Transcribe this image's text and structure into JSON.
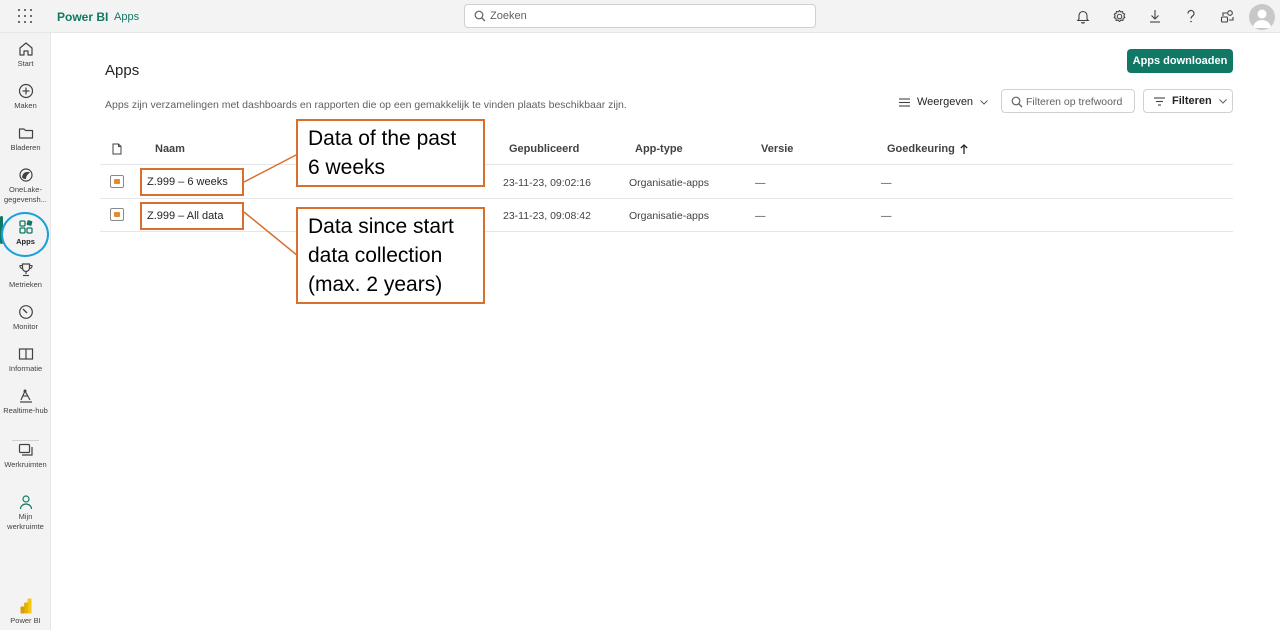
{
  "topbar": {
    "brand": "Power BI",
    "section": "Apps",
    "search_placeholder": "Zoeken"
  },
  "rail": {
    "items": [
      {
        "label": "Start",
        "icon": "home-icon"
      },
      {
        "label": "Maken",
        "icon": "plus-circle-icon"
      },
      {
        "label": "Bladeren",
        "icon": "folder-icon"
      },
      {
        "label": "OneLake-gegevensh...",
        "icon": "onelake-icon"
      },
      {
        "label": "Apps",
        "icon": "apps-icon",
        "active": true
      },
      {
        "label": "Metrieken",
        "icon": "trophy-icon"
      },
      {
        "label": "Monitor",
        "icon": "monitor-icon"
      },
      {
        "label": "Informatie",
        "icon": "book-icon"
      },
      {
        "label": "Realtime-hub",
        "icon": "realtime-hub-icon"
      },
      {
        "label": "Werkruimten",
        "icon": "workspaces-icon"
      },
      {
        "label": "Mijn werkruimte",
        "icon": "person-icon"
      },
      {
        "label": "Power BI",
        "icon": "powerbi-logo-icon"
      }
    ]
  },
  "main": {
    "title": "Apps",
    "description": "Apps zijn verzamelingen met dashboards en rapporten die op een gemakkelijk te vinden plaats beschikbaar zijn.",
    "download_button": "Apps downloaden",
    "view_button": "Weergeven",
    "filter_placeholder": "Filteren op trefwoord",
    "filter_button": "Filteren"
  },
  "table": {
    "columns": [
      "Naam",
      "Gepubliceerd",
      "App-type",
      "Versie",
      "Goedkeuring"
    ],
    "rows": [
      {
        "name": "Z.999 – 6 weeks",
        "published": "23-11-23, 09:02:16",
        "type": "Organisatie-apps",
        "version": "—",
        "approval": "—"
      },
      {
        "name": "Z.999 – All data",
        "published": "23-11-23, 09:08:42",
        "type": "Organisatie-apps",
        "version": "—",
        "approval": "—"
      }
    ]
  },
  "callouts": [
    {
      "text_line1": "Data of the past",
      "text_line2": "6 weeks"
    },
    {
      "text_line1": "Data since start",
      "text_line2": "data collection",
      "text_line3": "(max. 2 years)"
    }
  ],
  "colors": {
    "accent": "#117865",
    "callout_border": "#d86f2e",
    "annotation_circle": "#1a9fd9"
  }
}
